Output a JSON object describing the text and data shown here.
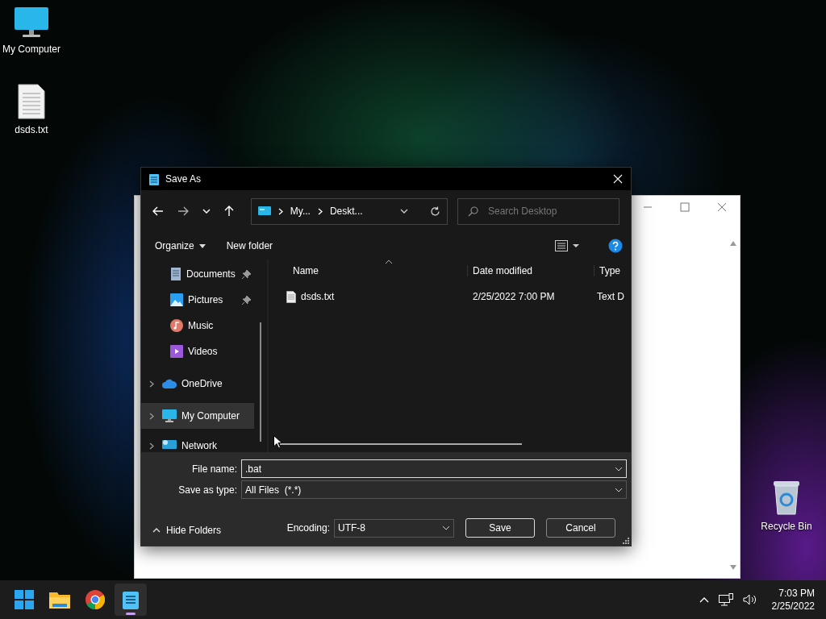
{
  "desktop_icons": [
    {
      "label": "My Computer",
      "kind": "computer"
    },
    {
      "label": "dsds.txt",
      "kind": "file"
    },
    {
      "label": "Recycle Bin",
      "kind": "recycle"
    }
  ],
  "dialog": {
    "title": "Save As",
    "breadcrumb": [
      "My...",
      "Deskt..."
    ],
    "search": {
      "placeholder": "Search Desktop"
    },
    "commands": {
      "organize": "Organize",
      "new_folder": "New folder"
    },
    "nav_items": [
      {
        "label": "Documents",
        "kind": "documents",
        "pinned": true,
        "expandable": false,
        "selected": false
      },
      {
        "label": "Pictures",
        "kind": "pictures",
        "pinned": true,
        "expandable": false,
        "selected": false
      },
      {
        "label": "Music",
        "kind": "music",
        "pinned": false,
        "expandable": false,
        "selected": false
      },
      {
        "label": "Videos",
        "kind": "videos",
        "pinned": false,
        "expandable": false,
        "selected": false
      },
      {
        "label": "OneDrive",
        "kind": "cloud",
        "pinned": false,
        "expandable": true,
        "selected": false
      },
      {
        "label": "My Computer",
        "kind": "computer",
        "pinned": false,
        "expandable": true,
        "selected": true
      },
      {
        "label": "Network",
        "kind": "network",
        "pinned": false,
        "expandable": true,
        "selected": false
      }
    ],
    "columns": [
      "Name",
      "Date modified",
      "Type"
    ],
    "files": [
      {
        "name": "dsds.txt",
        "date": "2/25/2022 7:00 PM",
        "type": "Text D"
      }
    ],
    "file_name": {
      "label": "File name:",
      "value": ".bat"
    },
    "save_type": {
      "label": "Save as type:",
      "value": "All Files  (*.*)"
    },
    "hide_folders": "Hide Folders",
    "encoding": {
      "label": "Encoding:",
      "value": "UTF-8"
    },
    "buttons": [
      "Save",
      "Cancel"
    ]
  },
  "taskbar": {
    "apps": [
      {
        "kind": "start",
        "active": false
      },
      {
        "kind": "folder",
        "active": false
      },
      {
        "kind": "browser",
        "active": false
      },
      {
        "kind": "notepad",
        "active": true
      }
    ],
    "time": "7:03 PM",
    "date": "2/25/2022"
  }
}
